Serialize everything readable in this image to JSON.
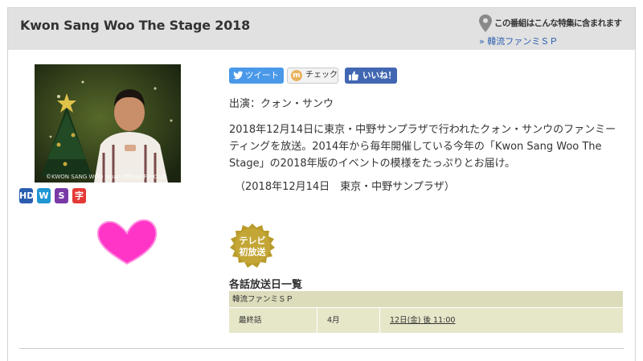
{
  "program": {
    "title": "Kwon Sang Woo The Stage 2018",
    "cast": "出演：クォン・サンウ",
    "description": "2018年12月14日に東京・中野サンプラザで行われたクォン・サンウのファンミーティングを放送。2014年から毎年開催している今年の「Kwon Sang Woo The Stage」の2018年版のイベントの模様をたっぷりとお届け。",
    "event_date": "（2018年12月14日　東京・中野サンプラザ）",
    "image_credit": "©KWON SANG WOO Japan Official FanClub"
  },
  "feature": {
    "label": "この番組はこんな特集に含まれます",
    "link": "» 韓流ファンミＳＰ"
  },
  "badges": [
    {
      "text": "HD",
      "color": "#2a5db0"
    },
    {
      "text": "W",
      "color": "#2196d3"
    },
    {
      "text": "S",
      "color": "#7a3aa6"
    },
    {
      "text": "字",
      "color": "#e53935"
    }
  ],
  "social": {
    "tweet": "ツイート",
    "check": "チェック",
    "check_icon": "m",
    "like": "いいね！"
  },
  "first_air_badge": "テレビ初放送",
  "first_air_lines": [
    "テレビ",
    "初放送"
  ],
  "schedule": {
    "heading": "各話放送日一覧",
    "section": "韓流ファンミＳＰ",
    "rows": [
      {
        "episode": "最終話",
        "month": "4月",
        "air_time": "12日(金) 後 11:00"
      }
    ]
  },
  "colors": {
    "header_bg": "#e1e1e1",
    "link": "#2a5db0",
    "table_bg": "#e6e6c9",
    "heart": "#ff35c8",
    "twitter": "#4a99e9",
    "facebook": "#4267b2"
  }
}
